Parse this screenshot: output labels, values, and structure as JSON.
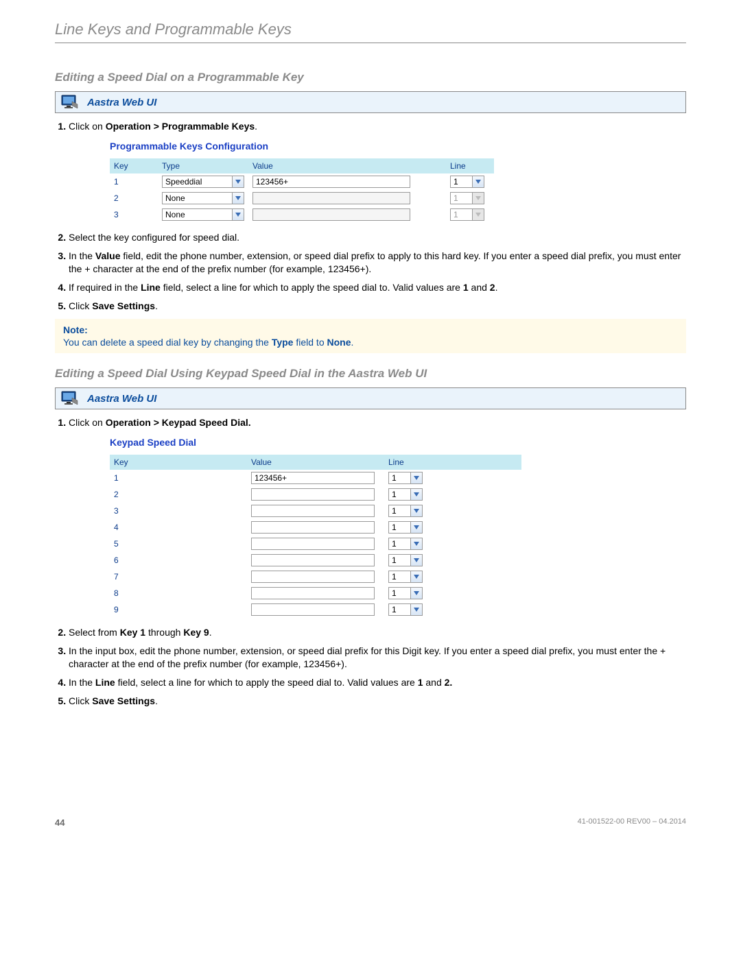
{
  "chapter_title": "Line Keys and Programmable Keys",
  "section1": {
    "title": "Editing a Speed Dial on a Programmable Key",
    "webui_label": "Aastra Web UI",
    "step1_pre": "Click on ",
    "step1_bold": "Operation > Programmable Keys",
    "step1_post": ".",
    "step2": "Select the key configured for speed dial.",
    "step3_a": "In the ",
    "step3_b": "Value",
    "step3_c": " field, edit the phone number, extension, or speed dial prefix to apply to this hard key. If you enter a speed dial prefix, you must enter the + character at the end of the prefix number (for example, 123456+).",
    "step4_a": "If required in the ",
    "step4_b": "Line",
    "step4_c": " field, select a line for which to apply the speed dial to. Valid values are ",
    "step4_d": "1",
    "step4_e": " and ",
    "step4_f": "2",
    "step4_g": ".",
    "step5_a": "Click ",
    "step5_b": "Save Settings",
    "step5_c": ".",
    "note_title": "Note:",
    "note_a": "You can delete a speed dial key by changing the ",
    "note_b": "Type",
    "note_c": " field to ",
    "note_d": "None",
    "note_e": ".",
    "shot": {
      "title": "Programmable Keys Configuration",
      "headers": [
        "Key",
        "Type",
        "Value",
        "Line"
      ],
      "rows": [
        {
          "key": "1",
          "type": "Speeddial",
          "value": "123456+",
          "line": "1",
          "disabled": false
        },
        {
          "key": "2",
          "type": "None",
          "value": "",
          "line": "1",
          "disabled": true
        },
        {
          "key": "3",
          "type": "None",
          "value": "",
          "line": "1",
          "disabled": true
        }
      ]
    }
  },
  "section2": {
    "title": "Editing a Speed Dial Using Keypad Speed Dial in the Aastra Web UI",
    "webui_label": "Aastra Web UI",
    "step1_pre": "Click on ",
    "step1_bold": "Operation > Keypad Speed Dial.",
    "step2_a": "Select from ",
    "step2_b": "Key 1",
    "step2_c": " through ",
    "step2_d": "Key 9",
    "step2_e": ".",
    "step3": "In the input box, edit the phone number, extension, or speed dial prefix for this Digit key. If you enter a speed dial prefix, you must enter the + character at the end of the prefix number (for example, 123456+).",
    "step4_a": "In the ",
    "step4_b": "Line",
    "step4_c": " field, select a line for which to apply the speed dial to. Valid values are ",
    "step4_d": "1",
    "step4_e": " and ",
    "step4_f": "2.",
    "step5_a": "Click ",
    "step5_b": "Save Settings",
    "step5_c": ".",
    "shot": {
      "title": "Keypad Speed Dial",
      "headers": [
        "Key",
        "Value",
        "Line"
      ],
      "rows": [
        {
          "key": "1",
          "value": "123456+",
          "line": "1"
        },
        {
          "key": "2",
          "value": "",
          "line": "1"
        },
        {
          "key": "3",
          "value": "",
          "line": "1"
        },
        {
          "key": "4",
          "value": "",
          "line": "1"
        },
        {
          "key": "5",
          "value": "",
          "line": "1"
        },
        {
          "key": "6",
          "value": "",
          "line": "1"
        },
        {
          "key": "7",
          "value": "",
          "line": "1"
        },
        {
          "key": "8",
          "value": "",
          "line": "1"
        },
        {
          "key": "9",
          "value": "",
          "line": "1"
        }
      ]
    }
  },
  "footer": {
    "page": "44",
    "docid": "41-001522-00 REV00 – 04.2014"
  }
}
